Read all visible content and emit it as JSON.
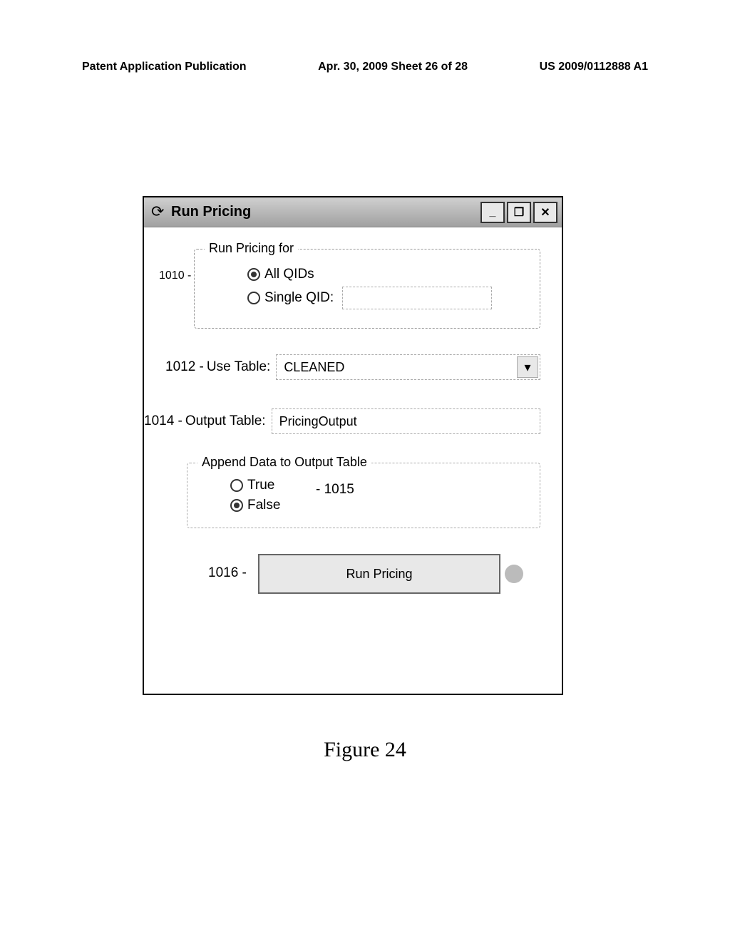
{
  "header": {
    "left": "Patent Application Publication",
    "center": "Apr. 30, 2009 Sheet 26 of 28",
    "right": "US 2009/0112888 A1"
  },
  "window": {
    "title": "Run Pricing"
  },
  "fieldset1": {
    "legend": "Run Pricing for",
    "ref": "1010 -",
    "radio_all": "All QIDs",
    "radio_single": "Single QID:"
  },
  "use_table": {
    "ref": "1012 -",
    "label": "Use Table:",
    "value": "CLEANED"
  },
  "output_table": {
    "ref": "1014 -",
    "label": "Output Table:",
    "value": "PricingOutput"
  },
  "fieldset2": {
    "legend": "Append Data to Output Table",
    "radio_true": "True",
    "radio_false": "False",
    "ref": "- 1015"
  },
  "button": {
    "ref": "1016 -",
    "label": "Run Pricing"
  },
  "figure_caption": "Figure 24"
}
